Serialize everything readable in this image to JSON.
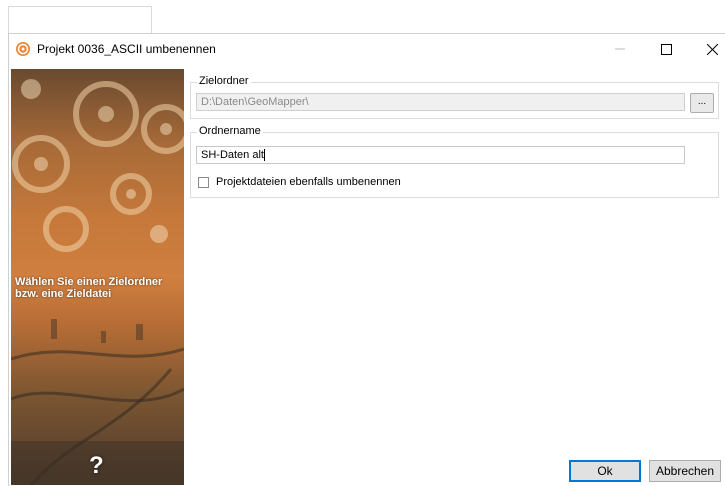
{
  "window": {
    "title": "Projekt 0036_ASCII umbenennen"
  },
  "side_panel": {
    "caption": "Wählen Sie einen Zielordner bzw. eine Zieldatei",
    "help_label": "?"
  },
  "target_folder": {
    "legend": "Zielordner",
    "value": "D:\\Daten\\GeoMapper\\",
    "browse_label": "..."
  },
  "folder_name": {
    "legend": "Ordnername",
    "value": "SH-Daten alt"
  },
  "rename_files": {
    "label": "Projektdateien ebenfalls umbenennen",
    "checked": false
  },
  "buttons": {
    "ok": "Ok",
    "cancel": "Abbrechen"
  },
  "colors": {
    "accent": "#0078d7",
    "side_panel": "#c4783a"
  },
  "icons": {
    "app": "gear-globe-icon",
    "minimize": "minimize-icon",
    "maximize": "maximize-icon",
    "close": "close-icon"
  }
}
